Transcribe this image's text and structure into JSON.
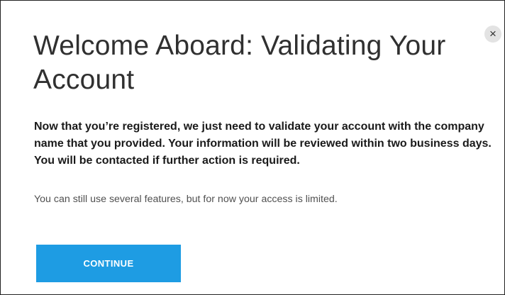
{
  "dialog": {
    "title": "Welcome Aboard: Validating Your Account",
    "close_icon": "×",
    "message_bold": "Now that you’re registered, we just need to validate your account with the company name that you provided. Your information will be reviewed within two business days. You will be contacted if further action is required.",
    "message": "You can still use several features, but for now your access is limited.",
    "continue_label": "CONTINUE"
  },
  "colors": {
    "primary_button": "#1e9ce3",
    "title_text": "#303030",
    "body_text": "#1a1a1a",
    "secondary_text": "#505050"
  },
  "icons": {
    "close": "close-icon"
  }
}
